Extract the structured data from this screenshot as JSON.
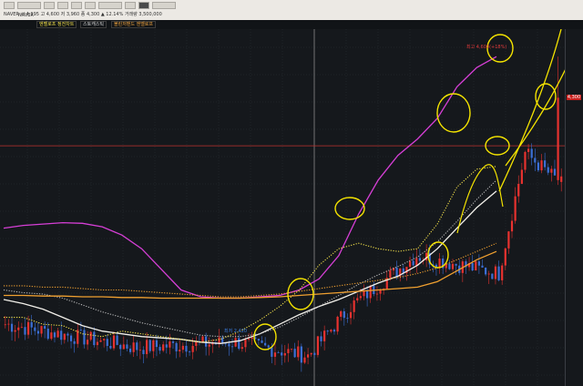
{
  "toolbar": {
    "code_text": "NAVER",
    "ohlc_text": "NAVER 시 4,195 고 4,600 저 3,960 종 4,300 ▲ 12.14% 거래량 3,500,000"
  },
  "legend": {
    "items": [
      {
        "label": "엔벨로프 정전차트",
        "color": "#f2e04a"
      },
      {
        "label": "스토캐스틱",
        "color": "#d8d8d8"
      },
      {
        "label": "볼린저밴드 엔벨로프",
        "color": "#f3a640"
      }
    ]
  },
  "labels": {
    "high": "최고 4,600(+18%)",
    "low": "최저 2,420",
    "current_price_tag": "4,300"
  },
  "chart_data": {
    "type": "line",
    "candles": {
      "up_color": "#e8322f",
      "down_color": "#3b6fd6",
      "count": 170,
      "segments": [
        {
          "from": 0,
          "to": 40,
          "close_start": 2650,
          "close_end": 2480
        },
        {
          "from": 40,
          "to": 70,
          "close_start": 2480,
          "close_end": 2520
        },
        {
          "from": 70,
          "to": 92,
          "close_start": 2520,
          "close_end": 2420
        },
        {
          "from": 92,
          "to": 105,
          "close_start": 2420,
          "close_end": 2780
        },
        {
          "from": 105,
          "to": 125,
          "close_start": 2780,
          "close_end": 3150
        },
        {
          "from": 125,
          "to": 150,
          "close_start": 3150,
          "close_end": 3020
        },
        {
          "from": 150,
          "to": 158,
          "close_start": 3020,
          "close_end": 3900
        },
        {
          "from": 158,
          "to": 170,
          "close_start": 3900,
          "close_end": 3650
        }
      ],
      "spike": {
        "index": 168,
        "open": 3700,
        "high": 4600,
        "close": 4300
      }
    },
    "overlay_lines": [
      {
        "name": "",
        "color": "#d63fd6",
        "style": "solid",
        "values": [
          3350,
          3370,
          3380,
          3390,
          3385,
          3360,
          3300,
          3200,
          3050,
          2900,
          2850,
          2840,
          2840,
          2850,
          2860,
          2900,
          2980,
          3150,
          3450,
          3700,
          3880,
          4000,
          4150,
          4380,
          4520,
          4600
        ]
      },
      {
        "name": "",
        "color": "#f2f0ea",
        "style": "solid",
        "values": [
          2830,
          2800,
          2760,
          2700,
          2640,
          2600,
          2580,
          2560,
          2550,
          2540,
          2520,
          2510,
          2530,
          2580,
          2650,
          2720,
          2780,
          2830,
          2890,
          2950,
          3000,
          3080,
          3200,
          3350,
          3500,
          3620
        ]
      },
      {
        "name": "",
        "color": "#b7b7b7",
        "style": "dotted",
        "values": [
          2900,
          2880,
          2870,
          2840,
          2790,
          2740,
          2700,
          2660,
          2630,
          2600,
          2570,
          2560,
          2560,
          2580,
          2630,
          2700,
          2780,
          2860,
          2940,
          3010,
          3070,
          3140,
          3250,
          3400,
          3560,
          3700
        ]
      },
      {
        "name": "",
        "color": "#f2e04a",
        "style": "dotted",
        "values": [
          2700,
          2700,
          2650,
          2640,
          2580,
          2560,
          2600,
          2580,
          2560,
          2540,
          2520,
          2540,
          2600,
          2680,
          2780,
          2900,
          3080,
          3200,
          3240,
          3200,
          3180,
          3200,
          3380,
          3650,
          3780,
          3800
        ]
      },
      {
        "name": "",
        "color": "#f0a030",
        "style": "dotted",
        "values": [
          2930,
          2930,
          2920,
          2920,
          2910,
          2900,
          2900,
          2890,
          2880,
          2870,
          2860,
          2850,
          2850,
          2860,
          2870,
          2890,
          2910,
          2930,
          2950,
          2970,
          2990,
          3020,
          3060,
          3120,
          3180,
          3240
        ]
      },
      {
        "name": "",
        "color": "#f0a030",
        "style": "solid",
        "values": [
          2860,
          2860,
          2855,
          2855,
          2850,
          2850,
          2845,
          2845,
          2840,
          2840,
          2840,
          2840,
          2840,
          2845,
          2850,
          2860,
          2870,
          2880,
          2890,
          2900,
          2910,
          2920,
          2960,
          3040,
          3120,
          3180
        ]
      }
    ],
    "annotations": {
      "circle_color": "#f5e400",
      "note": "yellow hand-drawn circles and trend lines"
    },
    "ylim": [
      2200,
      4800
    ],
    "horizontal_line": {
      "value": 3950,
      "color": "#c0322e"
    },
    "grid": true
  }
}
